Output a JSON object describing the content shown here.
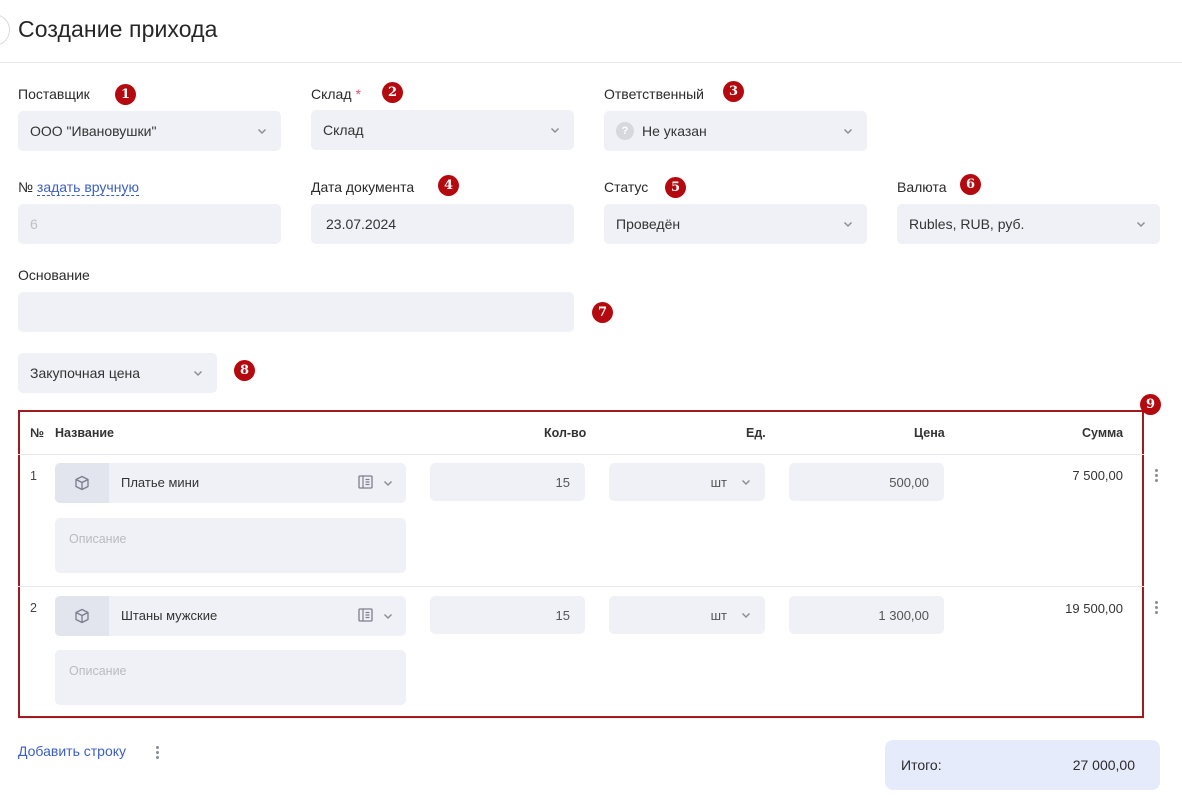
{
  "header": {
    "title": "Создание прихода"
  },
  "form": {
    "supplier": {
      "label": "Поставщик",
      "value": "ООО \"Ивановушки\""
    },
    "warehouse": {
      "label": "Склад",
      "required_mark": "*",
      "value": "Склад"
    },
    "responsible": {
      "label": "Ответственный",
      "value": "Не указан",
      "icon": "?"
    },
    "number": {
      "label": "№",
      "link": "задать вручную",
      "value": "6"
    },
    "doc_date": {
      "label": "Дата документа",
      "value": "23.07.2024"
    },
    "status": {
      "label": "Статус",
      "value": "Проведён"
    },
    "currency": {
      "label": "Валюта",
      "value": "Rubles, RUB, руб."
    },
    "basis": {
      "label": "Основание",
      "value": ""
    },
    "price_type": {
      "value": "Закупочная цена"
    }
  },
  "badges": [
    "1",
    "2",
    "3",
    "4",
    "5",
    "6",
    "7",
    "8",
    "9"
  ],
  "table": {
    "columns": {
      "num": "№",
      "name": "Название",
      "qty": "Кол-во",
      "unit": "Ед.",
      "price": "Цена",
      "sum": "Сумма"
    },
    "rows": [
      {
        "num": "1",
        "name": "Платье мини",
        "qty": "15",
        "unit": "шт",
        "price": "500,00",
        "sum": "7 500,00",
        "desc_placeholder": "Описание"
      },
      {
        "num": "2",
        "name": "Штаны мужские",
        "qty": "15",
        "unit": "шт",
        "price": "1 300,00",
        "sum": "19 500,00",
        "desc_placeholder": "Описание"
      }
    ]
  },
  "footer": {
    "add_row": "Добавить строку",
    "total_label": "Итого:",
    "total_value": "27 000,00"
  },
  "colors": {
    "accent": "#3b5fc6",
    "badge": "#b4090e",
    "frame": "#a11b1e",
    "field_bg": "#f0f1f6",
    "total_bg": "#e6ebfb"
  }
}
